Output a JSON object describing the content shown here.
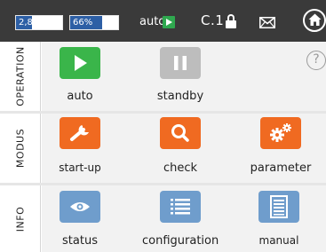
{
  "status_bar": {
    "pressure": {
      "label": "2,8 bar",
      "fill_fraction": 0.35,
      "fill_color": "#2d5fa5"
    },
    "level": {
      "label": "66%",
      "fill_fraction": 0.66,
      "fill_color": "#2d5fa5"
    },
    "mode": {
      "label": "auto",
      "icon": "play-icon",
      "icon_color": "#2fa84f"
    },
    "access_level": {
      "label": "C.1",
      "icon": "lock-icon"
    },
    "mail": {
      "icon": "mail-icon"
    },
    "home": {
      "icon": "home-icon"
    }
  },
  "sections": {
    "operation": {
      "title": "OPERATION",
      "tiles": [
        {
          "label": "auto",
          "icon": "play-icon",
          "color": "#3ab54a"
        },
        {
          "label": "standby",
          "icon": "pause-icon",
          "color": "#bdbdbd"
        }
      ],
      "help_icon": "?"
    },
    "modus": {
      "title": "MODUS",
      "tiles": [
        {
          "label": "start-up",
          "icon": "wrench-icon",
          "color": "#f06a21"
        },
        {
          "label": "check",
          "icon": "magnifier-icon",
          "color": "#f06a21"
        },
        {
          "label": "parameter",
          "icon": "gears-icon",
          "color": "#f06a21"
        }
      ]
    },
    "info": {
      "title": "INFO",
      "tiles": [
        {
          "label": "status",
          "icon": "eye-icon",
          "color": "#6f9dcc"
        },
        {
          "label": "configuration",
          "icon": "list-icon",
          "color": "#6f9dcc"
        },
        {
          "label": "manual",
          "icon": "document-icon",
          "color": "#6f9dcc"
        }
      ]
    }
  }
}
